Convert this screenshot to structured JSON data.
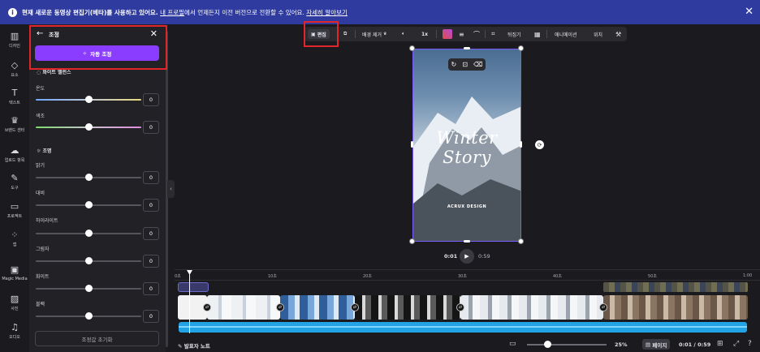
{
  "banner": {
    "text_bold": "현재 새로운 동영상 편집기(베타)를 사용하고 있어요.",
    "link1": "내 프로필",
    "text_mid": "에서 언제든지 이전 버전으로 전환할 수 있어요.",
    "link2": "자세히 알아보기"
  },
  "rail": {
    "items": [
      {
        "label": "디자인",
        "icon": "layout-icon"
      },
      {
        "label": "요소",
        "icon": "shapes-icon"
      },
      {
        "label": "텍스트",
        "icon": "text-icon"
      },
      {
        "label": "브랜드 센터",
        "icon": "brand-icon"
      },
      {
        "label": "업로드 항목",
        "icon": "upload-icon"
      },
      {
        "label": "도구",
        "icon": "draw-icon"
      },
      {
        "label": "프로젝트",
        "icon": "folder-icon"
      },
      {
        "label": "앱",
        "icon": "apps-icon"
      },
      {
        "label": "Magic Media",
        "icon": "magic-media-icon"
      },
      {
        "label": "사진",
        "icon": "photo-icon"
      },
      {
        "label": "오디오",
        "icon": "audio-icon"
      }
    ]
  },
  "panel": {
    "title": "조정",
    "auto_button": "자동 조정",
    "white_balance": "화이트 밸런스",
    "lighting": "조명",
    "sliders": [
      {
        "label": "온도",
        "value": "0",
        "level": 0.5
      },
      {
        "label": "색조",
        "value": "0",
        "level": 0.5
      },
      {
        "label": "밝기",
        "value": "0",
        "level": 0.5
      },
      {
        "label": "대비",
        "value": "0",
        "level": 0.5
      },
      {
        "label": "하이라이트",
        "value": "0",
        "level": 0.5
      },
      {
        "label": "그림자",
        "value": "0",
        "level": 0.5
      },
      {
        "label": "화이트",
        "value": "0",
        "level": 0.5
      },
      {
        "label": "블랙",
        "value": "0",
        "level": 0.5
      }
    ],
    "reset_button": "조정값 초기화"
  },
  "toolbar": {
    "edit": "편집",
    "bg_remove": "배경 제거",
    "speed": "1x",
    "flip": "뒤집기",
    "animate": "애니메이션",
    "position": "위치"
  },
  "canvas": {
    "title": "Winter Story",
    "subtitle": "ACRUX DESIGN"
  },
  "player": {
    "current": "0:01",
    "duration": "0:59"
  },
  "timeline": {
    "ticks": [
      "0초",
      "10초",
      "20초",
      "30초",
      "40초",
      "50초",
      "1:00"
    ]
  },
  "bottom": {
    "notes": "발표자 노트",
    "zoom": "25%",
    "page": "페이지",
    "time": "0:01 / 0:59"
  }
}
